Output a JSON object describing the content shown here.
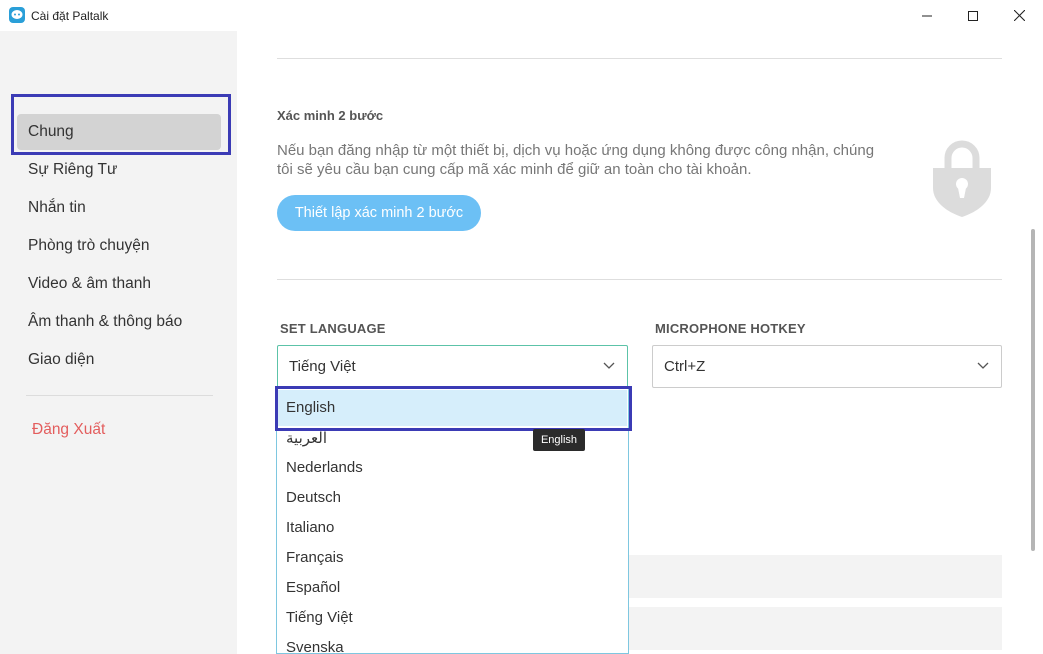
{
  "window": {
    "title": "Cài đặt Paltalk"
  },
  "sidebar": {
    "items": [
      {
        "label": "Chung",
        "active": true
      },
      {
        "label": "Sự Riêng Tư"
      },
      {
        "label": "Nhắn tin"
      },
      {
        "label": "Phòng trò chuyện"
      },
      {
        "label": "Video & âm thanh"
      },
      {
        "label": "Âm thanh & thông báo"
      },
      {
        "label": "Giao diện"
      }
    ],
    "logout_label": "Đăng Xuất"
  },
  "two_step": {
    "title": "Xác minh 2 bước",
    "description": "Nếu bạn đăng nhập từ một thiết bị, dịch vụ hoặc ứng dụng không được công nhận, chúng tôi sẽ yêu cầu bạn cung cấp mã xác minh để giữ an toàn cho tài khoản.",
    "button_label": "Thiết lập xác minh 2 bước"
  },
  "language": {
    "label": "SET LANGUAGE",
    "selected": "Tiếng Việt",
    "options": [
      "English",
      "العربية",
      "Nederlands",
      "Deutsch",
      "Italiano",
      "Français",
      "Español",
      "Tiếng Việt",
      "Svenska"
    ],
    "highlighted": "English",
    "tooltip": "English"
  },
  "hotkey": {
    "label": "MICROPHONE HOTKEY",
    "selected": "Ctrl+Z"
  },
  "colors": {
    "accent": "#6cc0f5",
    "logout": "#e35d5d",
    "highlight": "#d6eefb"
  }
}
